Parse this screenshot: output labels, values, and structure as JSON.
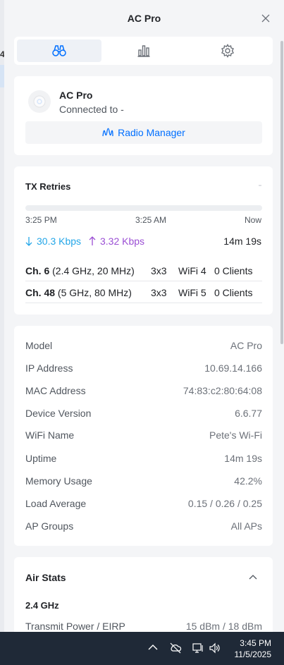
{
  "header": {
    "title": "AC Pro"
  },
  "tabs": [
    {
      "icon": "binoculars-icon",
      "active": true
    },
    {
      "icon": "bar-chart-icon",
      "active": false
    },
    {
      "icon": "gear-icon",
      "active": false
    }
  ],
  "device": {
    "name": "AC Pro",
    "status": "Connected to -",
    "radio_manager_label": "Radio Manager"
  },
  "tx": {
    "title": "TX Retries",
    "times": [
      "3:25 PM",
      "3:25 AM",
      "Now"
    ],
    "down_rate": "30.3 Kbps",
    "up_rate": "3.32 Kbps",
    "uptime": "14m 19s",
    "channels": [
      {
        "ch": "Ch. 6",
        "detail": " (2.4 GHz, 20 MHz)",
        "mimo": "3x3",
        "wifi": "WiFi 4",
        "clients": "0 Clients"
      },
      {
        "ch": "Ch. 48",
        "detail": " (5 GHz, 80 MHz)",
        "mimo": "3x3",
        "wifi": "WiFi 5",
        "clients": "0 Clients"
      }
    ]
  },
  "info": [
    {
      "key": "Model",
      "value": "AC Pro"
    },
    {
      "key": "IP Address",
      "value": "10.69.14.166"
    },
    {
      "key": "MAC Address",
      "value": "74:83:c2:80:64:08"
    },
    {
      "key": "Device Version",
      "value": "6.6.77"
    },
    {
      "key": "WiFi Name",
      "value": "Pete's Wi-Fi"
    },
    {
      "key": "Uptime",
      "value": "14m 19s"
    },
    {
      "key": "Memory Usage",
      "value": "42.2%"
    },
    {
      "key": "Load Average",
      "value": "0.15 / 0.26 / 0.25"
    },
    {
      "key": "AP Groups",
      "value": "All APs"
    }
  ],
  "air": {
    "title": "Air Stats",
    "band": "2.4 GHz",
    "rows": [
      {
        "key": "Transmit Power / EIRP",
        "value": "15 dBm / 18 dBm"
      }
    ]
  },
  "taskbar": {
    "time": "3:45 PM",
    "date": "11/5/2025"
  },
  "colors": {
    "accent": "#006fff",
    "down": "#23a6e8",
    "up": "#9b4fd4",
    "taskbar": "#1f2937"
  }
}
